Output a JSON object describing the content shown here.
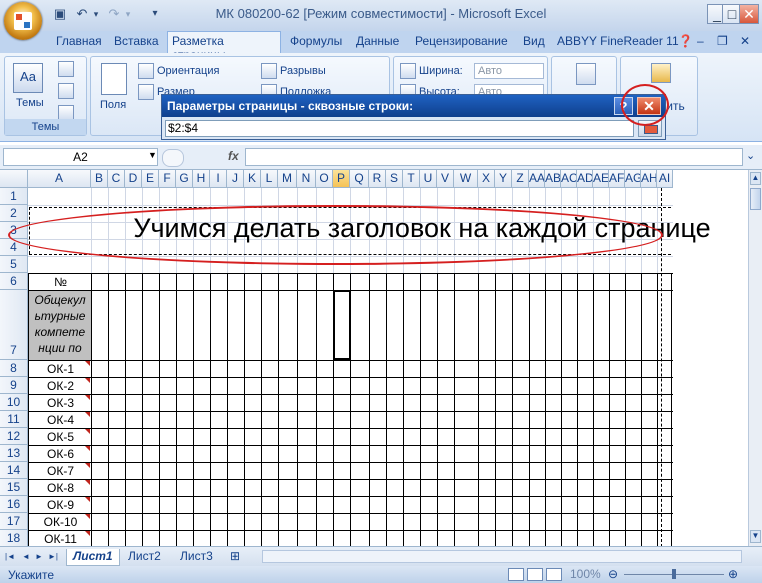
{
  "app": {
    "window_title": "МК 080200-62  [Режим совместимости] - Microsoft Excel",
    "window_controls": {
      "minimize": "_",
      "maximize": "□",
      "close": "✕"
    }
  },
  "quick_access": {
    "save_icon": "save-icon",
    "undo_icon": "undo-icon",
    "redo_icon": "redo-icon"
  },
  "ribbon_tabs": [
    "Главная",
    "Вставка",
    "Разметка страницы",
    "Формулы",
    "Данные",
    "Рецензирование",
    "Вид",
    "ABBYY FineReader 11"
  ],
  "active_tab": "Разметка страницы",
  "ribbon": {
    "themes": {
      "big_label": "Темы",
      "group_label": "Темы"
    },
    "page_setup": {
      "margins": "Поля",
      "orientation": "Ориентация",
      "size": "Размер",
      "breaks": "Разрывы",
      "background": "Подложка"
    },
    "scale": {
      "width_label": "Ширина:",
      "width_value": "Авто",
      "height_label": "Высота:",
      "height_value": "Авто"
    },
    "arrange": {
      "partial_label": "онить"
    }
  },
  "dialog": {
    "title": "Параметры страницы - сквозные строки:",
    "help": "?",
    "close": "✕",
    "value": "$2:$4"
  },
  "formula_bar": {
    "name_box": "A2",
    "fx": "fx",
    "value": ""
  },
  "sheet": {
    "columns": [
      "A",
      "B",
      "C",
      "D",
      "E",
      "F",
      "G",
      "H",
      "I",
      "J",
      "K",
      "L",
      "M",
      "N",
      "O",
      "P",
      "Q",
      "R",
      "S",
      "T",
      "U",
      "V",
      "W",
      "X",
      "Y",
      "Z",
      "AA",
      "AB",
      "AC",
      "AD",
      "AE",
      "AF",
      "AG",
      "AH",
      "AI"
    ],
    "selected_column": "P",
    "rows": [
      "1",
      "2",
      "3",
      "4",
      "5",
      "6",
      "7",
      "8",
      "9",
      "10",
      "11",
      "12",
      "13",
      "14",
      "15",
      "16",
      "17",
      "18"
    ],
    "heading_text": "Учимся делать заголовок на каждой странице",
    "a6": "№",
    "a7": "Общекул ьтурные компете нции по",
    "ok_codes": [
      "ОК-1",
      "ОК-2",
      "ОК-3",
      "ОК-4",
      "ОК-5",
      "ОК-6",
      "ОК-7",
      "ОК-8",
      "ОК-9",
      "ОК-10",
      "ОК-11"
    ]
  },
  "sheet_tabs": [
    "Лист1",
    "Лист2",
    "Лист3"
  ],
  "active_sheet": "Лист1",
  "status": {
    "mode": "Укажите",
    "zoom": "100%"
  }
}
